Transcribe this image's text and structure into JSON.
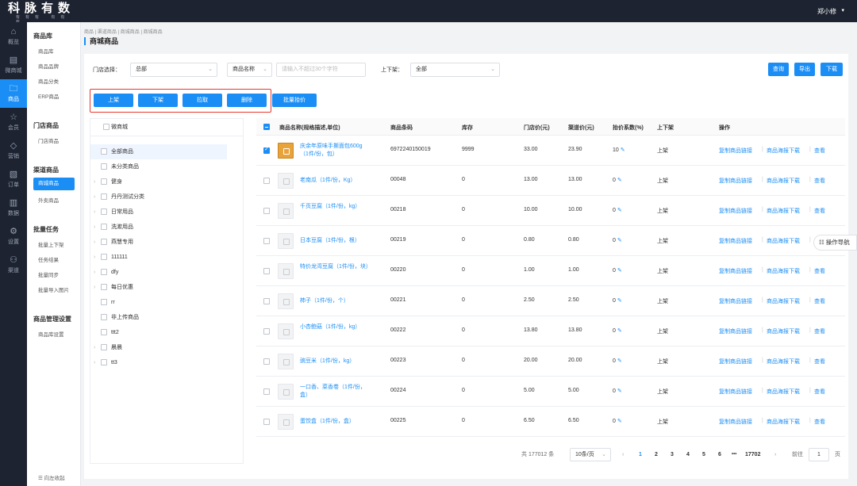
{
  "brand": {
    "title": "科脉有数",
    "subtitle": "有有有 有有有"
  },
  "header": {
    "user": "郑小修",
    "user_caret": "▾"
  },
  "rail": [
    {
      "label": "概览",
      "icon": "⌂"
    },
    {
      "label": "微商城",
      "icon": "▤"
    },
    {
      "label": "商品",
      "icon": "🗀"
    },
    {
      "label": "会员",
      "icon": "☆"
    },
    {
      "label": "营销",
      "icon": "◇"
    },
    {
      "label": "订单",
      "icon": "▧"
    },
    {
      "label": "数据",
      "icon": "▥"
    },
    {
      "label": "设置",
      "icon": "⚙"
    },
    {
      "label": "渠道",
      "icon": "⚇"
    }
  ],
  "submenu": {
    "g1": "商品库",
    "g1_items": [
      "商品库",
      "商品品牌",
      "商品分类",
      "ERP商品"
    ],
    "g2": "门店商品",
    "g2_items": [
      "门店商品"
    ],
    "g3": "渠道商品",
    "g3_items": [
      "商城商品",
      "外卖商品"
    ],
    "g4": "批量任务",
    "g4_items": [
      "批量上下架",
      "任务结果",
      "批量同步",
      "批量导入图片"
    ],
    "g5": "商品管理设置",
    "g5_items": [
      "商品库设置"
    ],
    "collapse": "☰  向左收起"
  },
  "breadcrumb": "商品  |  渠道商品  |  商城商品  |  商城商品",
  "page_title": "商城商品",
  "filters": {
    "store_label": "门店选择：",
    "store_value": "总部",
    "field_value": "商品名称",
    "search_placeholder": "请输入不超过30个字符",
    "status_label": "上下架：",
    "status_value": "全部"
  },
  "toolbar": {
    "query": "查询",
    "export": "导出",
    "download": "下载"
  },
  "actions": {
    "up": "上架",
    "down": "下架",
    "pull": "拉取",
    "delete": "删除",
    "batch_price": "批量抬价"
  },
  "tree": {
    "header": "微商城",
    "nodes": [
      {
        "label": "全部商品",
        "arrow": ""
      },
      {
        "label": "未分类商品",
        "arrow": ""
      },
      {
        "label": "健身",
        "arrow": "›"
      },
      {
        "label": "丹丹测试分类",
        "arrow": "›"
      },
      {
        "label": "日常用品",
        "arrow": "›"
      },
      {
        "label": "洗漱用品",
        "arrow": "›"
      },
      {
        "label": "燕慧专用",
        "arrow": "›"
      },
      {
        "label": "111111",
        "arrow": "›"
      },
      {
        "label": "dfy",
        "arrow": "›"
      },
      {
        "label": "每日优惠",
        "arrow": "›"
      },
      {
        "label": "rr",
        "arrow": ""
      },
      {
        "label": "非上传商品",
        "arrow": ""
      },
      {
        "label": "ttt2",
        "arrow": ""
      },
      {
        "label": "晨晨",
        "arrow": "›"
      },
      {
        "label": "tt3",
        "arrow": "›"
      }
    ]
  },
  "table": {
    "headers": {
      "name": "商品名称(规格描述,单位)",
      "code": "商品条码",
      "stock": "库存",
      "store_price": "门店价(元)",
      "channel_price": "渠道价(元)",
      "coef": "抬价系数(%)",
      "status": "上下架",
      "ops": "操作"
    },
    "ops": {
      "copy_link": "复制商品链接",
      "poster": "商品海报下载",
      "view": "查看"
    },
    "edit_icon": "✎",
    "rows": [
      {
        "name": "庆余年原味手撕面包600g（1件/份，包）",
        "code": "6972240150019",
        "stock": "9999",
        "store": "33.00",
        "channel": "23.90",
        "coef": "10",
        "status": "上架",
        "checked": true,
        "img": true
      },
      {
        "name": "老南瓜（1件/份，Kg）",
        "code": "00048",
        "stock": "0",
        "store": "13.00",
        "channel": "13.00",
        "coef": "0",
        "status": "上架",
        "checked": false,
        "img": false
      },
      {
        "name": "千页豆腐（1件/份，kg）",
        "code": "00218",
        "stock": "0",
        "store": "10.00",
        "channel": "10.00",
        "coef": "0",
        "status": "上架",
        "checked": false,
        "img": false
      },
      {
        "name": "日本豆腐（1件/份，根）",
        "code": "00219",
        "stock": "0",
        "store": "0.80",
        "channel": "0.80",
        "coef": "0",
        "status": "上架",
        "checked": false,
        "img": false
      },
      {
        "name": "特价龙湾豆腐（1件/份，块）",
        "code": "00220",
        "stock": "0",
        "store": "1.00",
        "channel": "1.00",
        "coef": "0",
        "status": "上架",
        "checked": false,
        "img": false
      },
      {
        "name": "柿子（1件/份，个）",
        "code": "00221",
        "stock": "0",
        "store": "2.50",
        "channel": "2.50",
        "coef": "0",
        "status": "上架",
        "checked": false,
        "img": false
      },
      {
        "name": "小杏鲍菇（1件/份，kg）",
        "code": "00222",
        "stock": "0",
        "store": "13.80",
        "channel": "13.80",
        "coef": "0",
        "status": "上架",
        "checked": false,
        "img": false
      },
      {
        "name": "豌豆米（1件/份，kg）",
        "code": "00223",
        "stock": "0",
        "store": "20.00",
        "channel": "20.00",
        "coef": "0",
        "status": "上架",
        "checked": false,
        "img": false
      },
      {
        "name": "一口香、菜香卷（1件/份，盒）",
        "code": "00224",
        "stock": "0",
        "store": "5.00",
        "channel": "5.00",
        "coef": "0",
        "status": "上架",
        "checked": false,
        "img": false
      },
      {
        "name": "蛋饺盒（1件/份，盒）",
        "code": "00225",
        "stock": "0",
        "store": "6.50",
        "channel": "6.50",
        "coef": "0",
        "status": "上架",
        "checked": false,
        "img": false
      }
    ]
  },
  "pager": {
    "total": "共 177012 条",
    "page_size": "10条/页",
    "prev": "‹",
    "pages": [
      "1",
      "2",
      "3",
      "4",
      "5",
      "6"
    ],
    "ellipsis": "•••",
    "last": "17702",
    "next": "›",
    "goto_label": "前往",
    "goto_value": "1",
    "goto_unit": "页"
  },
  "guide": "☷ 操作导航",
  "colors": {
    "accent": "#1b8ef5",
    "dark": "#1d2330",
    "highlight": "#e8372c"
  }
}
